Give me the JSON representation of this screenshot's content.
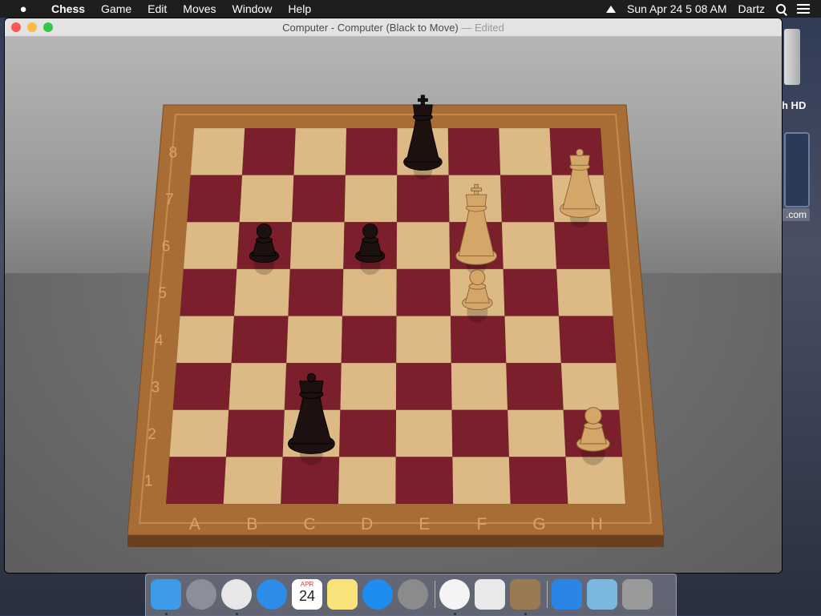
{
  "menubar": {
    "apple": "",
    "app_name": "Chess",
    "items": [
      "Game",
      "Edit",
      "Moves",
      "Window",
      "Help"
    ],
    "clock": "Sun Apr 24  5 08 AM",
    "user": "Dartz"
  },
  "desktop": {
    "hd_label": "h HD",
    "com_label": ".com"
  },
  "window": {
    "title": "Computer - Computer   (Black to Move)",
    "edited": "— Edited"
  },
  "board": {
    "ranks": [
      "8",
      "7",
      "6",
      "5",
      "4",
      "3",
      "2",
      "1"
    ],
    "files": [
      "A",
      "B",
      "C",
      "D",
      "E",
      "F",
      "G",
      "H"
    ],
    "colors": {
      "dark_square": "#7a1f2b",
      "light_square": "#dcb985",
      "frame": "#a86d35",
      "black_piece": "#1c1010",
      "white_piece": "#d4a768"
    },
    "pieces": [
      {
        "square": "e8",
        "type": "king",
        "color": "black"
      },
      {
        "square": "h7",
        "type": "queen",
        "color": "white"
      },
      {
        "square": "f6",
        "type": "king",
        "color": "white"
      },
      {
        "square": "b6",
        "type": "pawn",
        "color": "black"
      },
      {
        "square": "d6",
        "type": "pawn",
        "color": "black"
      },
      {
        "square": "f5",
        "type": "pawn",
        "color": "white"
      },
      {
        "square": "c2",
        "type": "queen",
        "color": "black"
      },
      {
        "square": "h2",
        "type": "pawn",
        "color": "white"
      }
    ]
  },
  "dock": {
    "items": [
      {
        "name": "Finder",
        "icon": "finder-icon",
        "color": "#3d9bea",
        "running": true
      },
      {
        "name": "Launchpad",
        "icon": "launchpad-icon",
        "color": "#8a8f99",
        "running": false
      },
      {
        "name": "Google Chrome",
        "icon": "chrome-icon",
        "color": "#e7e7e7",
        "running": true
      },
      {
        "name": "Safari",
        "icon": "safari-icon",
        "color": "#2d8de8",
        "running": false
      },
      {
        "name": "Calendar",
        "icon": "calendar-icon",
        "color": "#ffffff",
        "running": false,
        "month": "APR",
        "day": "24"
      },
      {
        "name": "Notes",
        "icon": "notes-icon",
        "color": "#f9e27a",
        "running": false
      },
      {
        "name": "App Store",
        "icon": "app-store-icon",
        "color": "#1f8cf0",
        "running": false
      },
      {
        "name": "System Preferences",
        "icon": "system-preferences-icon",
        "color": "#8b8b8b",
        "running": false
      },
      {
        "name": "iTunes",
        "icon": "itunes-icon",
        "color": "#f4f4f4",
        "running": true
      },
      {
        "name": "Script Editor",
        "icon": "script-editor-icon",
        "color": "#e9e9e9",
        "running": false
      },
      {
        "name": "Chess",
        "icon": "chess-icon",
        "color": "#9a7a50",
        "running": true
      },
      {
        "name": "Applications",
        "icon": "applications-folder-icon",
        "color": "#2a86e6",
        "running": false
      },
      {
        "name": "Downloads",
        "icon": "downloads-folder-icon",
        "color": "#7cb7e0",
        "running": false
      },
      {
        "name": "Trash",
        "icon": "trash-icon",
        "color": "#9a9a9a",
        "running": false
      }
    ]
  }
}
